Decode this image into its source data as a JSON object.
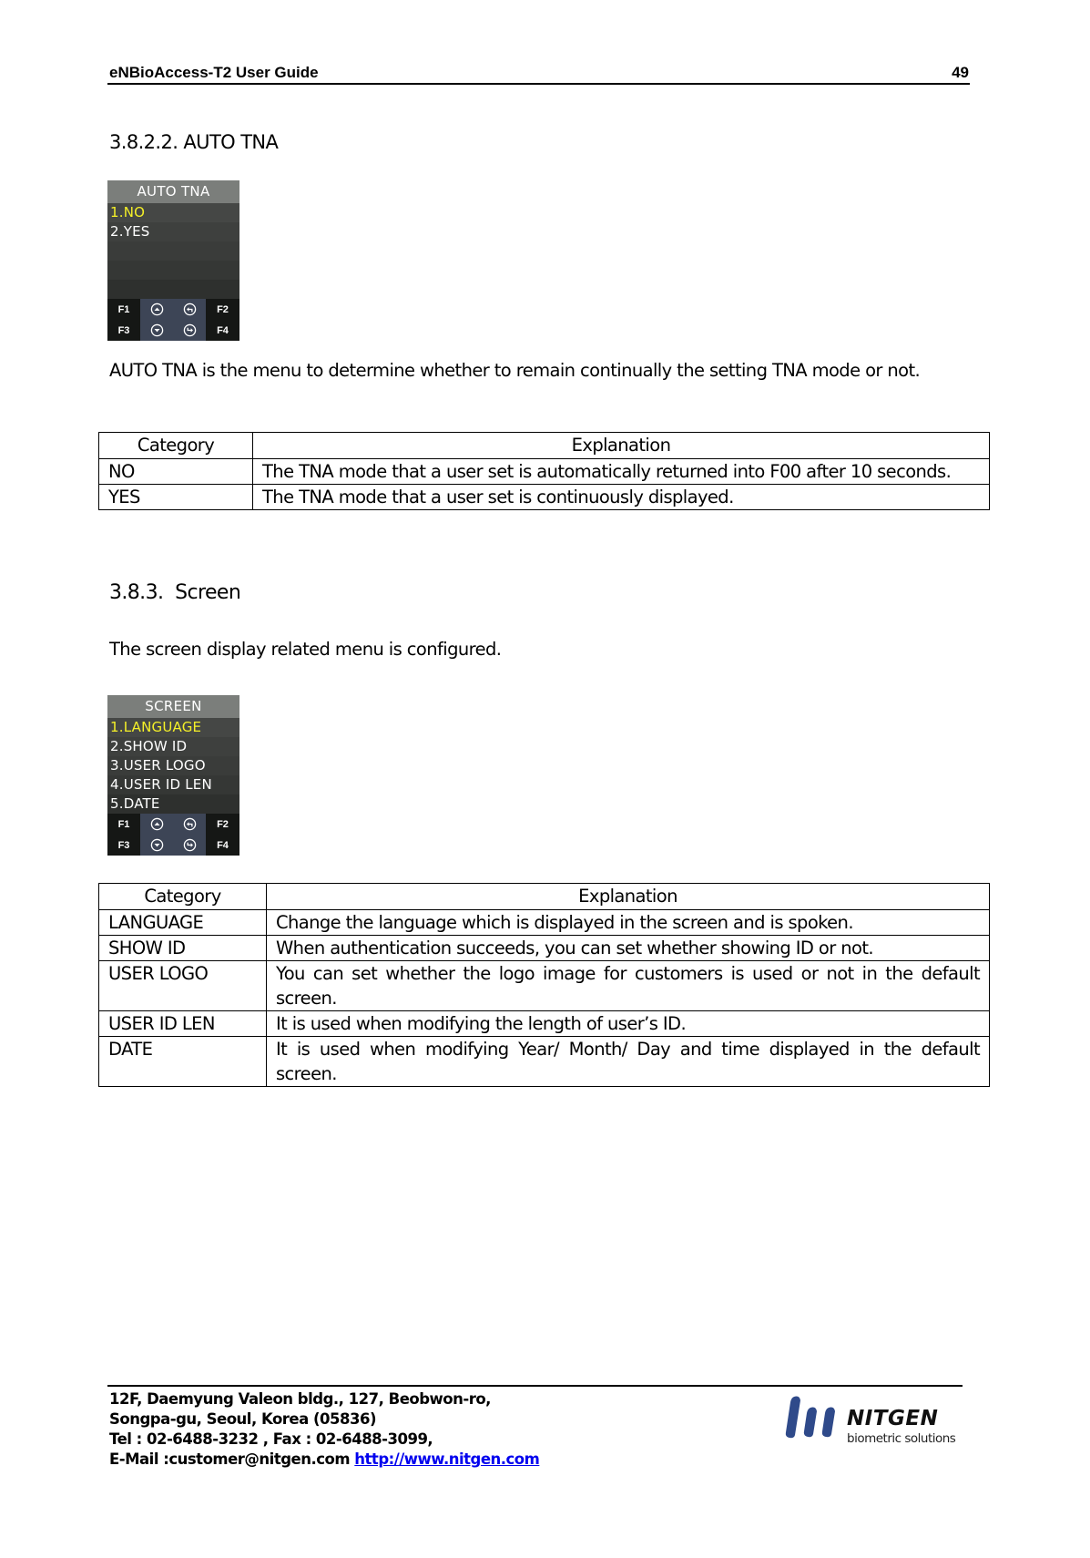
{
  "header": {
    "title": "eNBioAccess-T2 User Guide",
    "page_number": "49"
  },
  "section_auto_tna": {
    "heading": "3.8.2.2. AUTO TNA",
    "device": {
      "title": "AUTO TNA",
      "items": [
        {
          "label": "1.NO",
          "selected": true
        },
        {
          "label": "2.YES",
          "selected": false
        },
        {
          "label": "",
          "selected": false
        },
        {
          "label": "",
          "selected": false
        },
        {
          "label": "",
          "selected": false
        }
      ],
      "keys": {
        "f1": "F1",
        "f2": "F2",
        "f3": "F3",
        "f4": "F4",
        "up": "up-icon",
        "back": "back-icon",
        "down": "down-icon",
        "enter": "enter-icon"
      },
      "colors": {
        "selected": "#f5f028",
        "title_bar": "#7b7e7b"
      }
    },
    "description": "AUTO TNA is the menu to determine whether to remain continually the setting TNA mode or not.",
    "table": {
      "headers": [
        "Category",
        "Explanation"
      ],
      "rows": [
        {
          "category": "NO",
          "explanation": "The TNA mode that a user set is automatically returned into F00 after 10 seconds."
        },
        {
          "category": "YES",
          "explanation": "The TNA mode that a user set is continuously displayed."
        }
      ]
    }
  },
  "section_screen": {
    "heading": "3.8.3.  Screen",
    "description": "The screen display related menu is configured.",
    "device": {
      "title": "SCREEN",
      "items": [
        {
          "label": "1.LANGUAGE",
          "selected": true
        },
        {
          "label": "2.SHOW ID",
          "selected": false
        },
        {
          "label": "3.USER LOGO",
          "selected": false
        },
        {
          "label": "4.USER ID LEN",
          "selected": false
        },
        {
          "label": "5.DATE",
          "selected": false
        }
      ],
      "keys": {
        "f1": "F1",
        "f2": "F2",
        "f3": "F3",
        "f4": "F4",
        "up": "up-icon",
        "back": "back-icon",
        "down": "down-icon",
        "enter": "enter-icon"
      }
    },
    "table": {
      "headers": [
        "Category",
        "Explanation"
      ],
      "rows": [
        {
          "category": "LANGUAGE",
          "explanation": "Change the language which is displayed in the screen and is spoken."
        },
        {
          "category": "SHOW ID",
          "explanation": "When authentication succeeds, you can set whether showing ID or not."
        },
        {
          "category": "USER LOGO",
          "explanation": "You can set whether the logo image for customers is used or not in the default screen."
        },
        {
          "category": "USER ID LEN",
          "explanation": "It is used when modifying the length of user’s ID."
        },
        {
          "category": "DATE",
          "explanation": "It is used when modifying Year/ Month/ Day and time displayed in the default screen."
        }
      ]
    }
  },
  "footer": {
    "address_line1": "12F, Daemyung Valeon bldg., 127, Beobwon-ro,",
    "address_line2": "Songpa-gu, Seoul, Korea (05836)",
    "phone_line": "Tel : 02-6488-3232 , Fax : 02-6488-3099,",
    "email_label": "E-Mail :customer@nitgen.com",
    "website": "http://www.nitgen.com",
    "logo": {
      "name": "NITGEN",
      "tagline": "biometric solutions",
      "color": "#2f4a8a"
    }
  }
}
